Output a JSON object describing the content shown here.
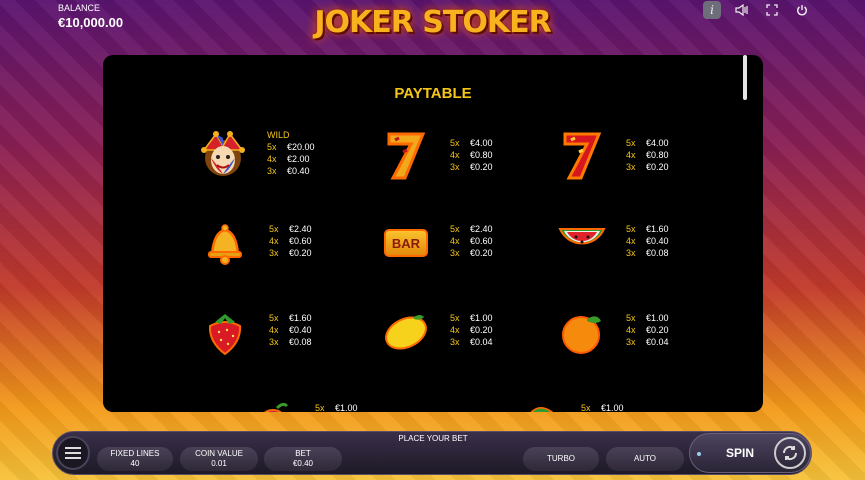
{
  "header": {
    "balance_label": "BALANCE",
    "balance_value": "€10,000.00",
    "logo_text": "JOKER STOKER",
    "icons": [
      "info-icon",
      "sound-icon",
      "fullscreen-icon",
      "power-icon"
    ],
    "info_glyph": "i"
  },
  "paytable": {
    "title": "PAYTABLE",
    "symbols": [
      {
        "name": "joker",
        "wild_label": "WILD",
        "pays": [
          {
            "x": "5x",
            "v": "€20.00"
          },
          {
            "x": "4x",
            "v": "€2.00"
          },
          {
            "x": "3x",
            "v": "€0.40"
          }
        ]
      },
      {
        "name": "seven-gold",
        "pays": [
          {
            "x": "5x",
            "v": "€4.00"
          },
          {
            "x": "4x",
            "v": "€0.80"
          },
          {
            "x": "3x",
            "v": "€0.20"
          }
        ]
      },
      {
        "name": "seven-red",
        "pays": [
          {
            "x": "5x",
            "v": "€4.00"
          },
          {
            "x": "4x",
            "v": "€0.80"
          },
          {
            "x": "3x",
            "v": "€0.20"
          }
        ]
      },
      {
        "name": "bell",
        "pays": [
          {
            "x": "5x",
            "v": "€2.40"
          },
          {
            "x": "4x",
            "v": "€0.60"
          },
          {
            "x": "3x",
            "v": "€0.20"
          }
        ]
      },
      {
        "name": "bar",
        "bar_text": "BAR",
        "pays": [
          {
            "x": "5x",
            "v": "€2.40"
          },
          {
            "x": "4x",
            "v": "€0.60"
          },
          {
            "x": "3x",
            "v": "€0.20"
          }
        ]
      },
      {
        "name": "watermelon",
        "pays": [
          {
            "x": "5x",
            "v": "€1.60"
          },
          {
            "x": "4x",
            "v": "€0.40"
          },
          {
            "x": "3x",
            "v": "€0.08"
          }
        ]
      },
      {
        "name": "strawberry",
        "pays": [
          {
            "x": "5x",
            "v": "€1.60"
          },
          {
            "x": "4x",
            "v": "€0.40"
          },
          {
            "x": "3x",
            "v": "€0.08"
          }
        ]
      },
      {
        "name": "lemon",
        "pays": [
          {
            "x": "5x",
            "v": "€1.00"
          },
          {
            "x": "4x",
            "v": "€0.20"
          },
          {
            "x": "3x",
            "v": "€0.04"
          }
        ]
      },
      {
        "name": "orange",
        "pays": [
          {
            "x": "5x",
            "v": "€1.00"
          },
          {
            "x": "4x",
            "v": "€0.20"
          },
          {
            "x": "3x",
            "v": "€0.04"
          }
        ]
      },
      {
        "name": "plum",
        "pays": [
          {
            "x": "5x",
            "v": "€1.00"
          }
        ]
      },
      {
        "name": "grapes",
        "pays": [
          {
            "x": "5x",
            "v": "€1.00"
          }
        ]
      }
    ]
  },
  "bottom": {
    "place_bet": "PLACE YOUR BET",
    "fixed_lines_label": "FIXED LINES",
    "fixed_lines_value": "40",
    "coin_value_label": "COIN VALUE",
    "coin_value_value": "0.01",
    "bet_label": "BET",
    "bet_value": "€0.40",
    "turbo_label": "TURBO",
    "auto_label": "AUTO",
    "spin_label": "SPIN"
  }
}
